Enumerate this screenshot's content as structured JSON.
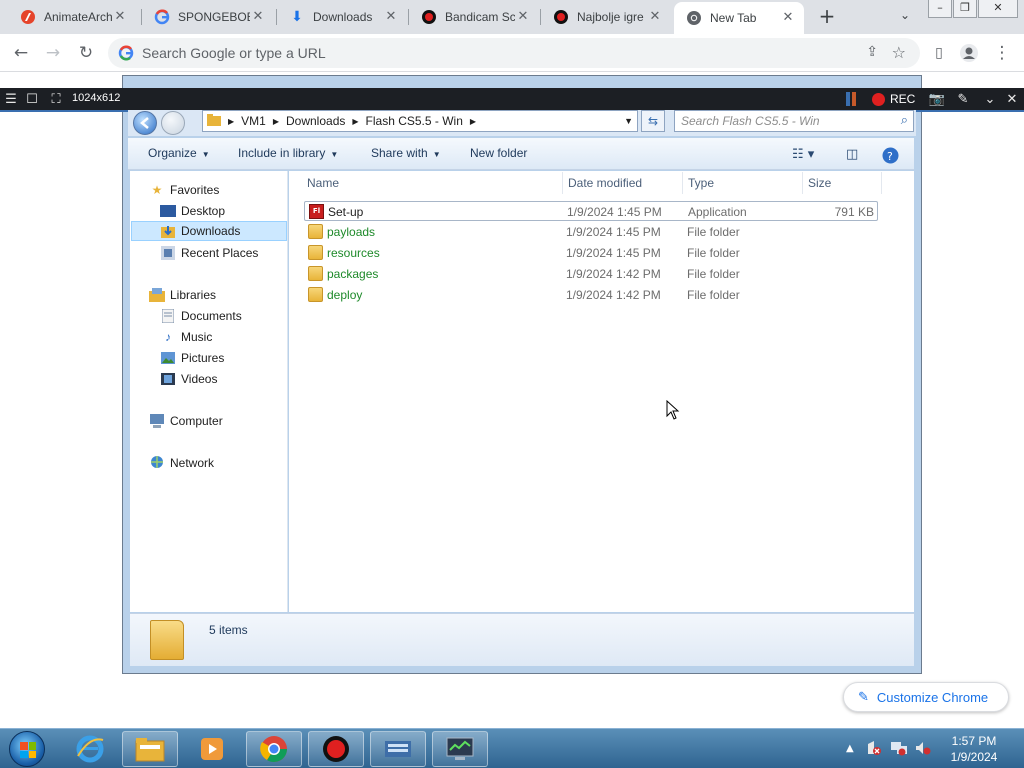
{
  "browser": {
    "tabs": [
      {
        "title": "AnimateArch",
        "icon": "animate-icon",
        "active": false
      },
      {
        "title": "SPONGEBOB",
        "icon": "google-icon",
        "active": false
      },
      {
        "title": "Downloads",
        "icon": "download-icon",
        "active": false
      },
      {
        "title": "Bandicam Sc",
        "icon": "bandicam-icon",
        "active": false
      },
      {
        "title": "Najbolje igre",
        "icon": "bandicam-icon",
        "active": false
      },
      {
        "title": "New Tab",
        "icon": "chrome-icon",
        "active": true
      }
    ],
    "omnibox_placeholder": "Search Google or type a URL",
    "customize_label": "Customize Chrome"
  },
  "recorder": {
    "resolution": "1024x612",
    "rec_label": "REC"
  },
  "explorer": {
    "breadcrumbs": [
      "VM1",
      "Downloads",
      "Flash CS5.5 - Win"
    ],
    "search_placeholder": "Search Flash CS5.5 - Win",
    "commands": {
      "organize": "Organize",
      "include": "Include in library",
      "share": "Share with",
      "new_folder": "New folder"
    },
    "nav": {
      "favorites": "Favorites",
      "desktop": "Desktop",
      "downloads": "Downloads",
      "recent": "Recent Places",
      "libraries": "Libraries",
      "documents": "Documents",
      "music": "Music",
      "pictures": "Pictures",
      "videos": "Videos",
      "computer": "Computer",
      "network": "Network"
    },
    "columns": {
      "name": "Name",
      "date": "Date modified",
      "type": "Type",
      "size": "Size"
    },
    "files": [
      {
        "name": "Set-up",
        "date": "1/9/2024 1:45 PM",
        "type": "Application",
        "size": "791 KB",
        "kind": "app"
      },
      {
        "name": "payloads",
        "date": "1/9/2024 1:45 PM",
        "type": "File folder",
        "size": "",
        "kind": "folder"
      },
      {
        "name": "resources",
        "date": "1/9/2024 1:45 PM",
        "type": "File folder",
        "size": "",
        "kind": "folder"
      },
      {
        "name": "packages",
        "date": "1/9/2024 1:42 PM",
        "type": "File folder",
        "size": "",
        "kind": "folder"
      },
      {
        "name": "deploy",
        "date": "1/9/2024 1:42 PM",
        "type": "File folder",
        "size": "",
        "kind": "folder"
      }
    ],
    "item_count": "5 items",
    "colors": {
      "folder_name": "#1e8a2a",
      "selection": "#cce8ff"
    }
  },
  "taskbar": {
    "time": "1:57 PM",
    "date": "1/9/2024"
  }
}
